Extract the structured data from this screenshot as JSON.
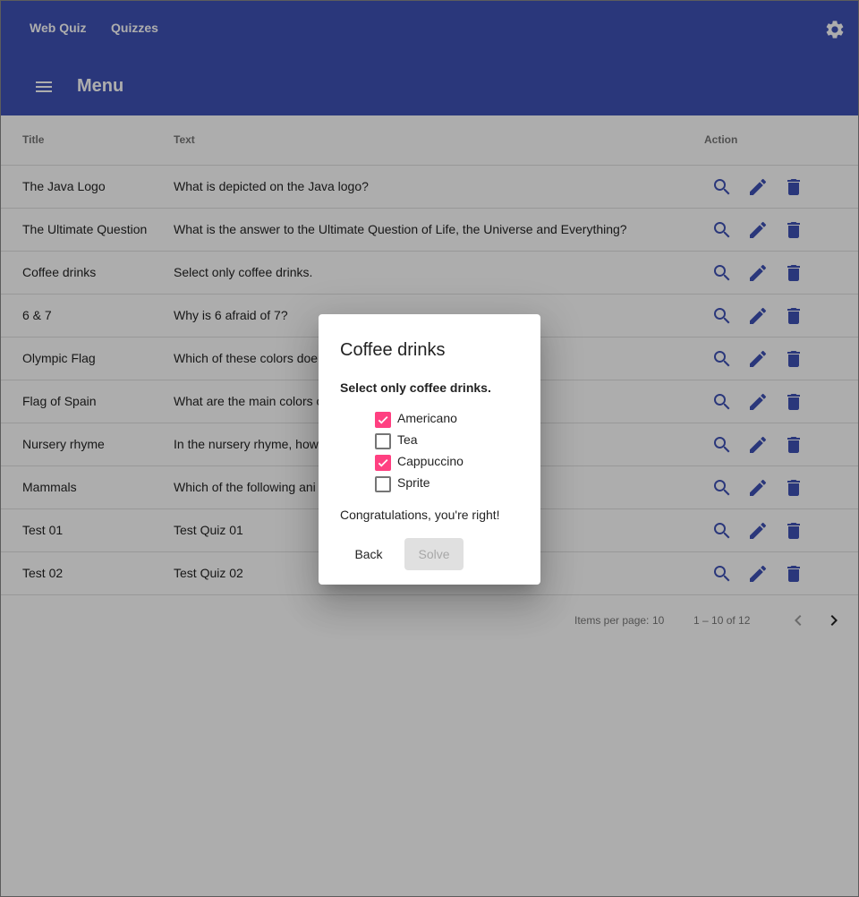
{
  "topbar": {
    "brand": "Web Quiz",
    "nav_quizzes": "Quizzes",
    "settings_icon": "gear-icon"
  },
  "menubar": {
    "title": "Menu",
    "menu_icon": "hamburger-icon"
  },
  "table": {
    "headers": {
      "title": "Title",
      "text": "Text",
      "action": "Action"
    },
    "rows": [
      {
        "title": "The Java Logo",
        "text": "What is depicted on the Java logo?"
      },
      {
        "title": "The Ultimate Question",
        "text": "What is the answer to the Ultimate Question of Life, the Universe and Everything?"
      },
      {
        "title": "Coffee drinks",
        "text": "Select only coffee drinks."
      },
      {
        "title": "6 & 7",
        "text": "Why is 6 afraid of 7?"
      },
      {
        "title": "Olympic Flag",
        "text": "Which of these colors doe"
      },
      {
        "title": "Flag of Spain",
        "text": "What are the main colors o"
      },
      {
        "title": "Nursery rhyme",
        "text": "In the nursery rhyme, how"
      },
      {
        "title": "Mammals",
        "text": "Which of the following ani"
      },
      {
        "title": "Test 01",
        "text": "Test Quiz 01"
      },
      {
        "title": "Test 02",
        "text": "Test Quiz 02"
      }
    ],
    "action_icons": [
      "search-icon",
      "pencil-icon",
      "trash-icon"
    ]
  },
  "paginator": {
    "items_per_page_label": "Items per page:",
    "items_per_page_value": "10",
    "range": "1 – 10 of 12"
  },
  "dialog": {
    "title": "Coffee drinks",
    "question": "Select only coffee drinks.",
    "options": [
      {
        "label": "Americano",
        "checked": true
      },
      {
        "label": "Tea",
        "checked": false
      },
      {
        "label": "Cappuccino",
        "checked": true
      },
      {
        "label": "Sprite",
        "checked": false
      }
    ],
    "result": "Congratulations, you're right!",
    "back_label": "Back",
    "solve_label": "Solve"
  },
  "colors": {
    "primary": "#3f51b5",
    "accent": "#ff4081"
  }
}
